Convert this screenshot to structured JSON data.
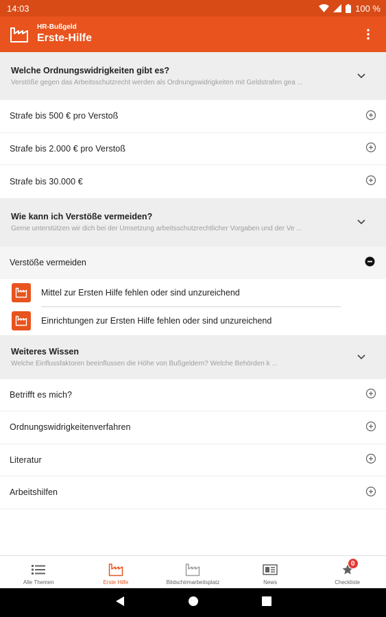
{
  "status_bar": {
    "time": "14:03",
    "battery": "100 %"
  },
  "app_bar": {
    "subtitle": "HR-Bußgeld",
    "title": "Erste-Hilfe",
    "menu_icon": "more-vert-icon"
  },
  "section1": {
    "title": "Welche Ordnungswidrigkeiten gibt es?",
    "description": "Verstöße gegen das Arbeitsschutzrecht werden als Ordnungswidrigkeiten mit Geldstrafen gea ...",
    "rows": [
      {
        "label": "Strafe bis 500 € pro Verstoß"
      },
      {
        "label": "Strafe bis 2.000 € pro Verstoß"
      },
      {
        "label": "Strafe bis 30.000 €"
      }
    ]
  },
  "section2": {
    "title": "Wie kann ich Verstöße vermeiden?",
    "description": "Gerne unterstützen wir dich bei der Umsetzung arbeitsschutzrechtlicher Vorgaben und der Ve ...",
    "open_row": {
      "label": "Verstöße vermeiden"
    },
    "items": [
      {
        "label": "Mittel zur Ersten Hilfe fehlen oder sind unzureichend"
      },
      {
        "label": "Einrichtungen zur Ersten Hilfe fehlen oder sind unzureichend"
      }
    ]
  },
  "section3": {
    "title": "Weiteres Wissen",
    "description": "Welche Einflussfaktoren beeinflussen die Höhe von Bußgeldern? Welche Behörden  k ...",
    "rows": [
      {
        "label": "Betrifft es mich?"
      },
      {
        "label": "Ordnungswidrigkeitenverfahren"
      },
      {
        "label": "Literatur"
      },
      {
        "label": "Arbeitshilfen"
      }
    ]
  },
  "bottom_nav": {
    "items": [
      {
        "label": "Alle Themen",
        "icon": "list-icon"
      },
      {
        "label": "Erste Hilfe",
        "icon": "factory-icon"
      },
      {
        "label": "Bildschirmarbeitsplatz",
        "icon": "factory-icon"
      },
      {
        "label": "News",
        "icon": "newspaper-icon"
      },
      {
        "label": "Checkliste",
        "icon": "star-icon",
        "badge": "0"
      }
    ]
  },
  "colors": {
    "accent": "#e8531e",
    "status_bar": "#d84a16",
    "section_bg": "#eeeeee",
    "badge": "#e53935"
  }
}
